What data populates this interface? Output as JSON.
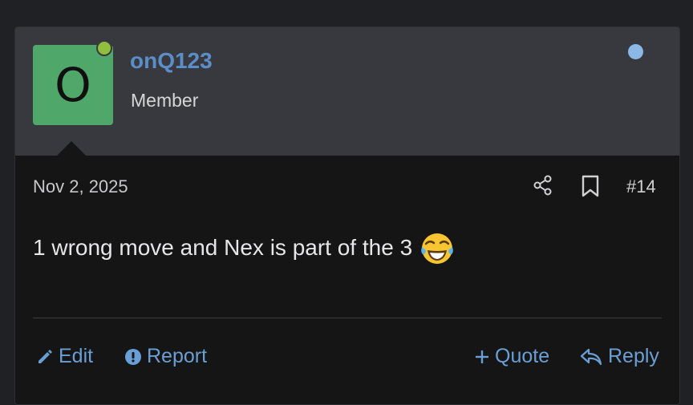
{
  "user": {
    "avatar_letter": "O",
    "avatar_color": "#4fa86a",
    "online_indicator_color": "#8fbf3c",
    "username": "onQ123",
    "title": "Member"
  },
  "post": {
    "date": "Nov 2, 2025",
    "number": "#14",
    "message": "1 wrong move and Nex is part of the 3",
    "emoji": "face-with-tears-of-joy-icon",
    "unread_indicator_color": "#8cb8e6"
  },
  "actions": {
    "edit": "Edit",
    "report": "Report",
    "quote": "Quote",
    "reply": "Reply"
  },
  "colors": {
    "link": "#6a9fd6",
    "username": "#5b8ec9"
  }
}
